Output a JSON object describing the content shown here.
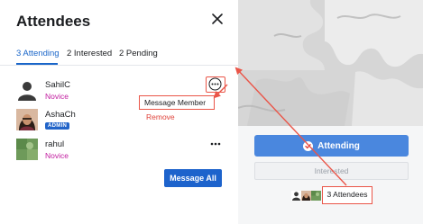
{
  "dialog": {
    "title": "Attendees",
    "tabs": [
      {
        "label": "3 Attending"
      },
      {
        "label": "2 Interested"
      },
      {
        "label": "2 Pending"
      }
    ],
    "attendees": [
      {
        "name": "SahilC",
        "role": "Novice"
      },
      {
        "name": "AshaCh",
        "role": "ADMIN"
      },
      {
        "name": "rahul",
        "role": "Novice"
      }
    ],
    "menu": {
      "items": [
        {
          "label": "Message Member"
        },
        {
          "label": "Remove"
        }
      ]
    },
    "message_all_label": "Message All"
  },
  "event": {
    "attending_label": "Attending",
    "interested_label": "Interested",
    "attendees_count_label": "3 Attendees"
  },
  "icons": {
    "close": "close-icon",
    "more": "more-horizontal-icon",
    "check": "check-circle-icon"
  },
  "colors": {
    "accent": "#1a66c9",
    "role_novice": "#c11c9f",
    "admin_badge": "#2264c8",
    "remove": "#e0443c",
    "annotation": "#ea5548",
    "attending_button": "#4a87de"
  }
}
